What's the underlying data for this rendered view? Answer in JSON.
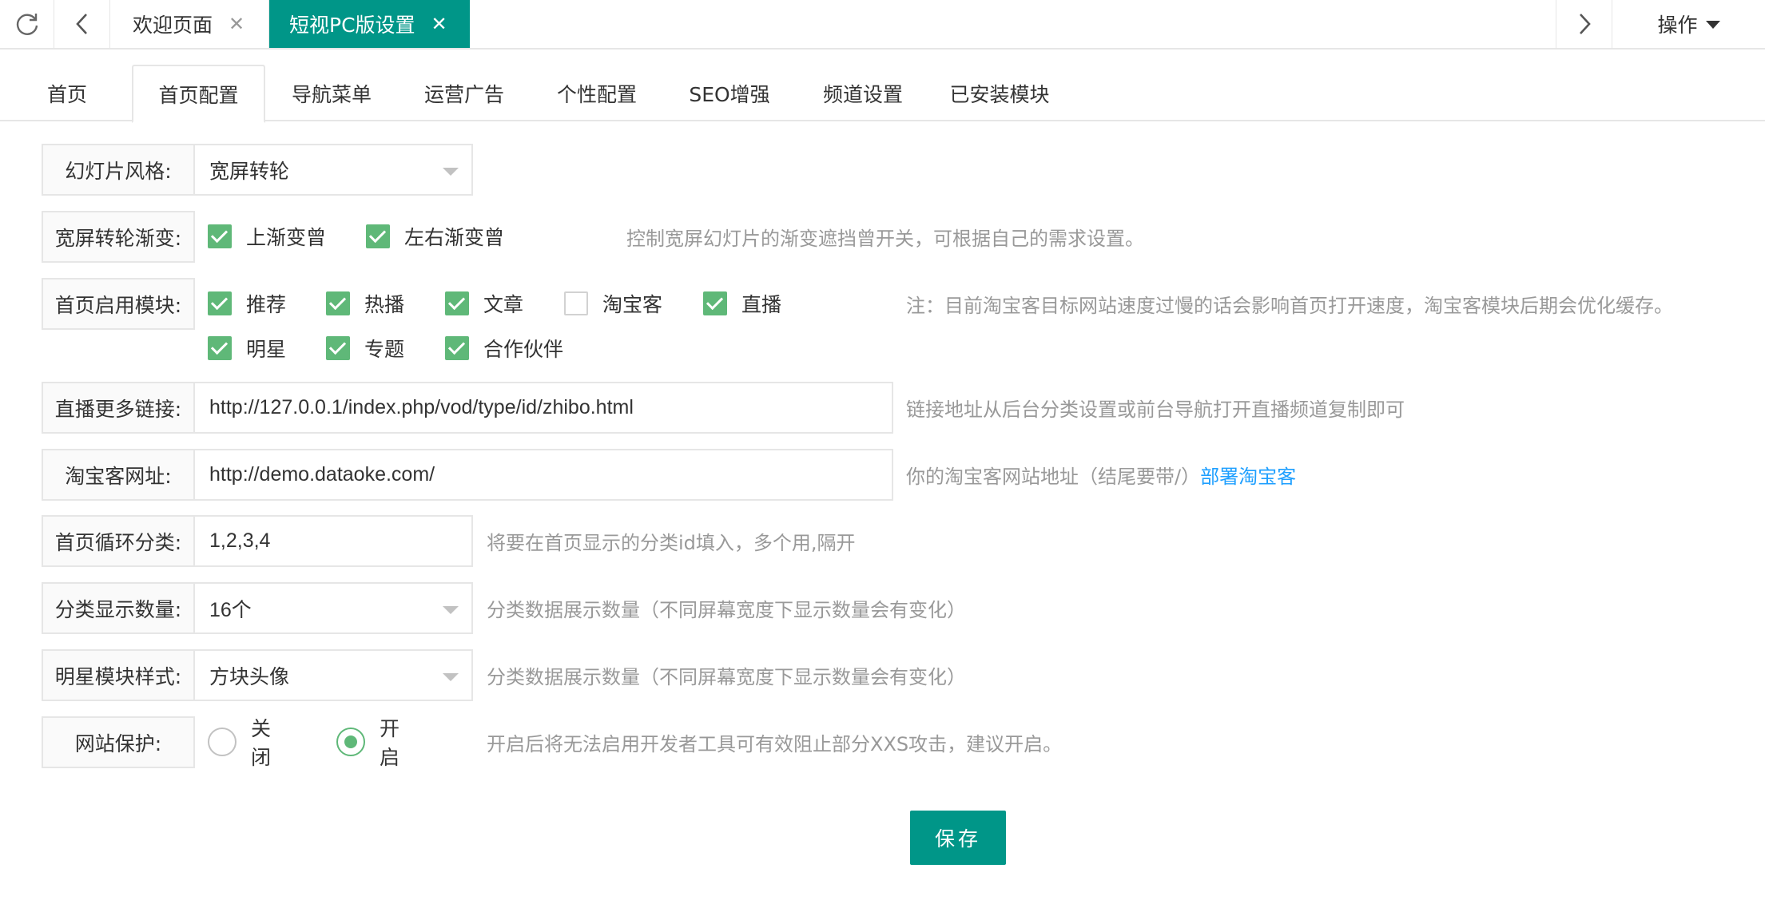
{
  "topbar": {
    "tabs": [
      {
        "label": "欢迎页面",
        "active": false
      },
      {
        "label": "短视PC版设置",
        "active": true
      }
    ],
    "ops_label": "操作"
  },
  "subtabs": [
    "首页",
    "首页配置",
    "导航菜单",
    "运营广告",
    "个性配置",
    "SEO增强",
    "频道设置",
    "已安装模块"
  ],
  "form": {
    "slide_style": {
      "label": "幻灯片风格:",
      "value": "宽屏转轮"
    },
    "fade": {
      "label": "宽屏转轮渐变:",
      "options": [
        {
          "label": "上渐变曾",
          "checked": true
        },
        {
          "label": "左右渐变曾",
          "checked": true
        }
      ],
      "hint": "控制宽屏幻灯片的渐变遮挡曾开关，可根据自己的需求设置。"
    },
    "modules": {
      "label": "首页启用模块:",
      "options": [
        {
          "label": "推荐",
          "checked": true
        },
        {
          "label": "热播",
          "checked": true
        },
        {
          "label": "文章",
          "checked": true
        },
        {
          "label": "淘宝客",
          "checked": false
        },
        {
          "label": "直播",
          "checked": true
        },
        {
          "label": "明星",
          "checked": true
        },
        {
          "label": "专题",
          "checked": true
        },
        {
          "label": "合作伙伴",
          "checked": true
        }
      ],
      "hint": "注：目前淘宝客目标网站速度过慢的话会影响首页打开速度，淘宝客模块后期会优化缓存。"
    },
    "live_link": {
      "label": "直播更多链接:",
      "value": "http://127.0.0.1/index.php/vod/type/id/zhibo.html",
      "hint": "链接地址从后台分类设置或前台导航打开直播频道复制即可"
    },
    "taobao_url": {
      "label": "淘宝客网址:",
      "value": "http://demo.dataoke.com/",
      "hint": "你的淘宝客网站地址（结尾要带/）",
      "link": "部署淘宝客"
    },
    "loop_category": {
      "label": "首页循环分类:",
      "value": "1,2,3,4",
      "hint": "将要在首页显示的分类id填入，多个用,隔开"
    },
    "category_count": {
      "label": "分类显示数量:",
      "value": "16个",
      "hint": "分类数据展示数量（不同屏幕宽度下显示数量会有变化）"
    },
    "star_style": {
      "label": "明星模块样式:",
      "value": "方块头像",
      "hint": "分类数据展示数量（不同屏幕宽度下显示数量会有变化）"
    },
    "protect": {
      "label": "网站保护:",
      "options": [
        {
          "label": "关闭",
          "checked": false
        },
        {
          "label": "开启",
          "checked": true
        }
      ],
      "hint": "开启后将无法启用开发者工具可有效阻止部分XXS攻击，建议开启。"
    },
    "save_label": "保存"
  },
  "colors": {
    "primary": "#009688",
    "check": "#5fb878",
    "hint": "#999999",
    "link": "#1e9fff"
  },
  "icons": [
    "refresh-icon",
    "chevron-left-icon",
    "close-icon",
    "chevron-right-icon",
    "caret-down-icon"
  ]
}
